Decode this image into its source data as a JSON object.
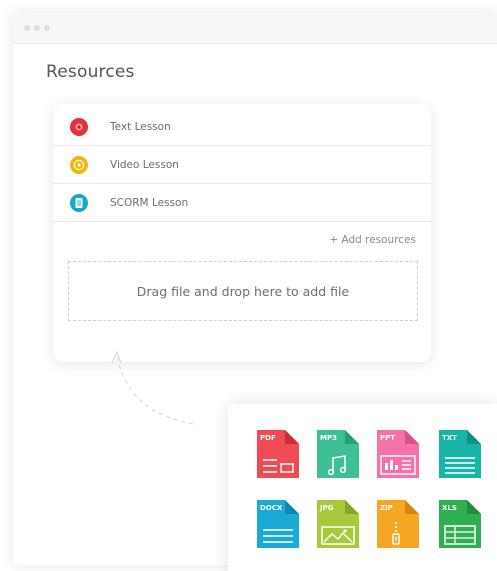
{
  "section_title": "Resources",
  "lessons": [
    {
      "label": "Text Lesson",
      "icon": "text-lesson-icon",
      "color": "#e0343a"
    },
    {
      "label": "Video Lesson",
      "icon": "play-icon",
      "color": "#f2b70c"
    },
    {
      "label": "SCORM Lesson",
      "icon": "document-icon",
      "color": "#13a9c7"
    }
  ],
  "add_resources_label": "+ Add resources",
  "dropzone_text": "Drag file and drop here to add file",
  "file_types": [
    {
      "label": "PDF",
      "color": "#ef4b55",
      "icon": "pdf-file-icon"
    },
    {
      "label": "MP3",
      "color": "#3fbf95",
      "icon": "mp3-file-icon"
    },
    {
      "label": "PPT",
      "color": "#f472a6",
      "icon": "ppt-file-icon"
    },
    {
      "label": "TXT",
      "color": "#18b5a7",
      "icon": "txt-file-icon"
    },
    {
      "label": "DOCX",
      "color": "#1ba9d6",
      "icon": "docx-file-icon"
    },
    {
      "label": "JPG",
      "color": "#a7c93c",
      "icon": "jpg-file-icon"
    },
    {
      "label": "ZIP",
      "color": "#f5a623",
      "icon": "zip-file-icon"
    },
    {
      "label": "XLS",
      "color": "#2fae52",
      "icon": "xls-file-icon"
    }
  ]
}
